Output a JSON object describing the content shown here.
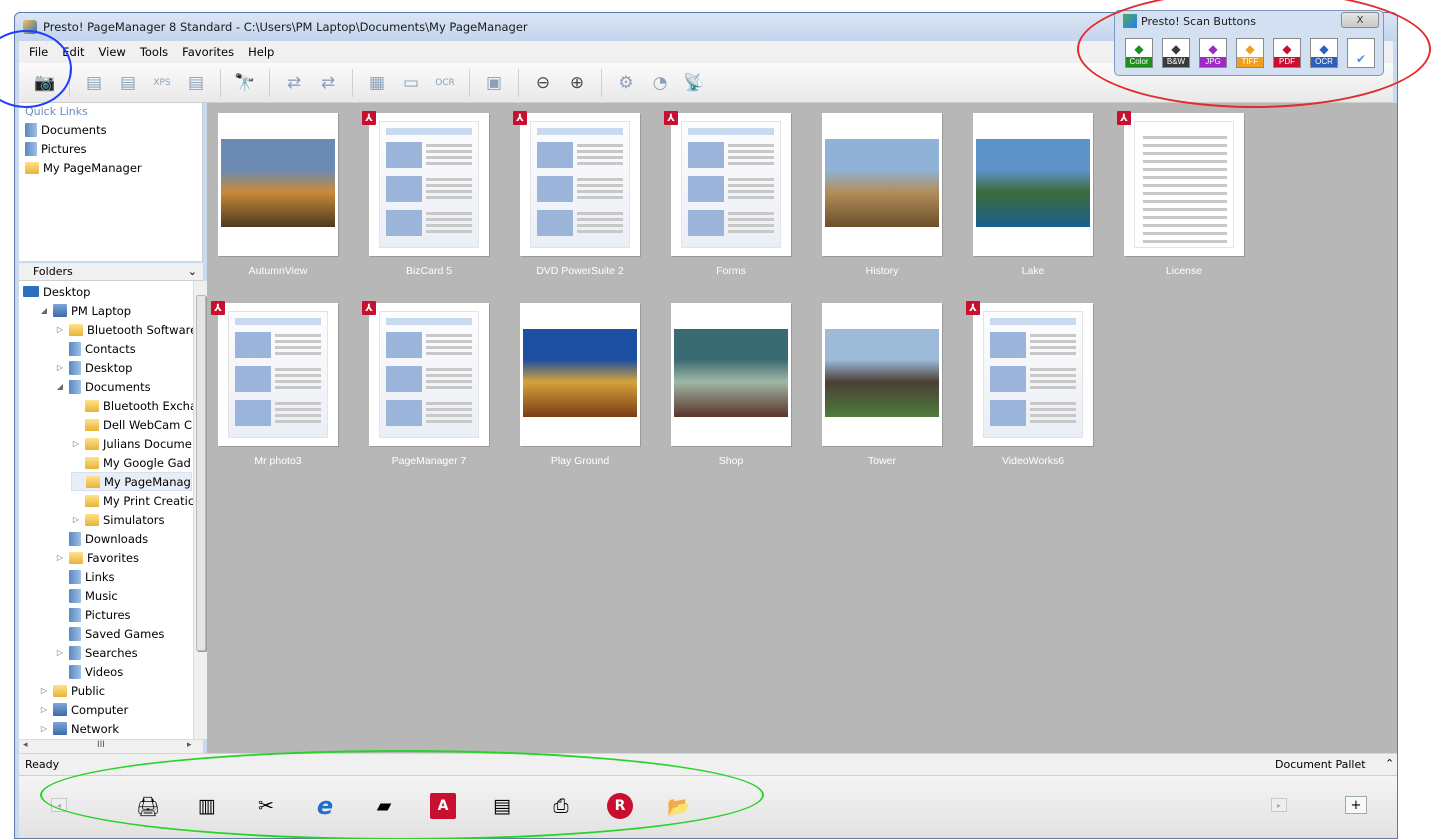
{
  "title_bar": {
    "title": "Presto! PageManager 8 Standard - C:\\Users\\PM Laptop\\Documents\\My PageManager"
  },
  "menu": [
    "File",
    "Edit",
    "View",
    "Tools",
    "Favorites",
    "Help"
  ],
  "toolbar": {
    "buttons": [
      {
        "name": "scan-button",
        "glyph": "📷"
      },
      {
        "name": "export-button",
        "glyph": "▤"
      },
      {
        "name": "pdf-button",
        "glyph": "▤"
      },
      {
        "name": "xps-button",
        "glyph": "XPS"
      },
      {
        "name": "stack-button",
        "glyph": "▤"
      },
      {
        "name": "find-button",
        "glyph": "🔭"
      },
      {
        "name": "move-button",
        "glyph": "⇄"
      },
      {
        "name": "copy-button",
        "glyph": "⇄"
      },
      {
        "name": "view-button",
        "glyph": "▦"
      },
      {
        "name": "frame-button",
        "glyph": "▭"
      },
      {
        "name": "ocr-button",
        "glyph": "OCR"
      },
      {
        "name": "preview-button",
        "glyph": "▣"
      },
      {
        "name": "zoom-out-button",
        "glyph": "⊖"
      },
      {
        "name": "zoom-in-button",
        "glyph": "⊕"
      },
      {
        "name": "settings-button",
        "glyph": "⚙"
      },
      {
        "name": "web-button",
        "glyph": "◔"
      },
      {
        "name": "wireless-button",
        "glyph": "📡"
      }
    ]
  },
  "quick_links": {
    "header": "Quick Links",
    "items": [
      "Documents",
      "Pictures",
      "My PageManager"
    ]
  },
  "folders": {
    "header": "Folders",
    "collapse_glyph": "⌄",
    "items": [
      {
        "label": "Desktop",
        "level": 0,
        "expander": "",
        "icon": "desktop"
      },
      {
        "label": "PM Laptop",
        "level": 1,
        "expander": "◢",
        "icon": "pc"
      },
      {
        "label": "Bluetooth Software",
        "level": 2,
        "expander": "▷",
        "icon": "folder"
      },
      {
        "label": "Contacts",
        "level": 2,
        "expander": "",
        "icon": "doc"
      },
      {
        "label": "Desktop",
        "level": 2,
        "expander": "▷",
        "icon": "doc"
      },
      {
        "label": "Documents",
        "level": 2,
        "expander": "◢",
        "icon": "doc"
      },
      {
        "label": "Bluetooth Excha",
        "level": 3,
        "expander": "",
        "icon": "folder"
      },
      {
        "label": "Dell WebCam C",
        "level": 3,
        "expander": "",
        "icon": "folder"
      },
      {
        "label": "Julians Docume",
        "level": 3,
        "expander": "▷",
        "icon": "folder"
      },
      {
        "label": "My Google Gad",
        "level": 3,
        "expander": "",
        "icon": "folder"
      },
      {
        "label": "My PageManag",
        "level": 3,
        "expander": "",
        "icon": "folder",
        "selected": true
      },
      {
        "label": "My Print Creatic",
        "level": 3,
        "expander": "",
        "icon": "folder"
      },
      {
        "label": "Simulators",
        "level": 3,
        "expander": "▷",
        "icon": "folder"
      },
      {
        "label": "Downloads",
        "level": 2,
        "expander": "",
        "icon": "doc"
      },
      {
        "label": "Favorites",
        "level": 2,
        "expander": "▷",
        "icon": "folder"
      },
      {
        "label": "Links",
        "level": 2,
        "expander": "",
        "icon": "doc"
      },
      {
        "label": "Music",
        "level": 2,
        "expander": "",
        "icon": "doc"
      },
      {
        "label": "Pictures",
        "level": 2,
        "expander": "",
        "icon": "doc"
      },
      {
        "label": "Saved Games",
        "level": 2,
        "expander": "",
        "icon": "doc"
      },
      {
        "label": "Searches",
        "level": 2,
        "expander": "▷",
        "icon": "doc"
      },
      {
        "label": "Videos",
        "level": 2,
        "expander": "",
        "icon": "doc"
      },
      {
        "label": "Public",
        "level": 1,
        "expander": "▷",
        "icon": "folder"
      },
      {
        "label": "Computer",
        "level": 1,
        "expander": "▷",
        "icon": "pc"
      },
      {
        "label": "Network",
        "level": 1,
        "expander": "▷",
        "icon": "pc"
      }
    ],
    "hscroll_glyph": "III"
  },
  "thumbnails": [
    {
      "label": "AutumnView",
      "pdf": false,
      "kind": "photo",
      "colors": [
        "#6b8bb3",
        "#c98a3a",
        "#4d3a1e"
      ]
    },
    {
      "label": "BizCard 5",
      "pdf": true,
      "kind": "doc"
    },
    {
      "label": "DVD PowerSuite 2",
      "pdf": true,
      "kind": "doc"
    },
    {
      "label": "Forms",
      "pdf": true,
      "kind": "doc"
    },
    {
      "label": "History",
      "pdf": false,
      "kind": "photo",
      "colors": [
        "#8fb2d6",
        "#b38e5c",
        "#6b4f2b"
      ]
    },
    {
      "label": "Lake",
      "pdf": false,
      "kind": "photo",
      "colors": [
        "#5e93c9",
        "#3d6b3a",
        "#1a5e8e"
      ]
    },
    {
      "label": "License",
      "pdf": true,
      "kind": "text"
    },
    {
      "label": "Mr photo3",
      "pdf": true,
      "kind": "doc"
    },
    {
      "label": "PageManager 7",
      "pdf": true,
      "kind": "doc"
    },
    {
      "label": "Play Ground",
      "pdf": false,
      "kind": "photo",
      "colors": [
        "#1d4fa3",
        "#d4a33a",
        "#7a3b15"
      ]
    },
    {
      "label": "Shop",
      "pdf": false,
      "kind": "photo",
      "colors": [
        "#3b6b72",
        "#9fb8a8",
        "#5a3328"
      ]
    },
    {
      "label": "Tower",
      "pdf": false,
      "kind": "photo",
      "colors": [
        "#9dbad8",
        "#4a4036",
        "#4e7b3b"
      ]
    },
    {
      "label": "VideoWorks6",
      "pdf": true,
      "kind": "doc"
    }
  ],
  "status": {
    "text": "Ready",
    "pallet_label": "Document Pallet",
    "pallet_caret": "⌃"
  },
  "pallet": {
    "items": [
      {
        "name": "fax-icon",
        "glyph": "🖨"
      },
      {
        "name": "archive-icon",
        "glyph": "▥"
      },
      {
        "name": "tools-icon",
        "glyph": "✂"
      },
      {
        "name": "ie-icon",
        "glyph": "e"
      },
      {
        "name": "note-icon",
        "glyph": "▰"
      },
      {
        "name": "acrobat-icon",
        "glyph": "A"
      },
      {
        "name": "document-icon",
        "glyph": "▤"
      },
      {
        "name": "printer-icon",
        "glyph": "⎙"
      },
      {
        "name": "finereader-icon",
        "glyph": "R"
      },
      {
        "name": "folder-open-icon",
        "glyph": "📂"
      }
    ],
    "plus": "+"
  },
  "scan_buttons": {
    "title": "Presto! Scan Buttons",
    "close": "X",
    "buttons": [
      {
        "label": "Color",
        "color": "#1e8e1e"
      },
      {
        "label": "B&W",
        "color": "#3a3a3a"
      },
      {
        "label": "JPG",
        "color": "#9b2bc2"
      },
      {
        "label": "TIFF",
        "color": "#f0a020"
      },
      {
        "label": "PDF",
        "color": "#c8102e"
      },
      {
        "label": "OCR",
        "color": "#2e5fb8"
      },
      {
        "label": "",
        "color": "#4a90e2"
      }
    ]
  }
}
